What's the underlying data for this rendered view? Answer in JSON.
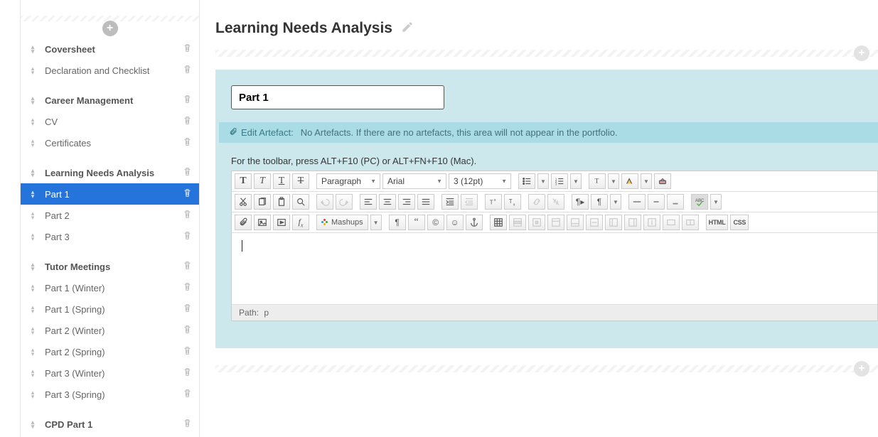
{
  "page": {
    "title": "Learning Needs Analysis"
  },
  "sidebar": {
    "groups": [
      {
        "header": "Coversheet",
        "items": [
          {
            "label": "Declaration and Checklist",
            "active": false
          }
        ]
      },
      {
        "header": "Career Management",
        "items": [
          {
            "label": "CV",
            "active": false
          },
          {
            "label": "Certificates",
            "active": false
          }
        ]
      },
      {
        "header": "Learning Needs Analysis",
        "items": [
          {
            "label": "Part 1",
            "active": true
          },
          {
            "label": "Part 2",
            "active": false
          },
          {
            "label": "Part 3",
            "active": false
          }
        ]
      },
      {
        "header": "Tutor Meetings",
        "items": [
          {
            "label": "Part 1 (Winter)",
            "active": false
          },
          {
            "label": "Part 1 (Spring)",
            "active": false
          },
          {
            "label": "Part 2 (Winter)",
            "active": false
          },
          {
            "label": "Part 2 (Spring)",
            "active": false
          },
          {
            "label": "Part 3 (Winter)",
            "active": false
          },
          {
            "label": "Part 3 (Spring)",
            "active": false
          }
        ]
      },
      {
        "header": "CPD Part 1",
        "items": []
      }
    ]
  },
  "editor": {
    "title_value": "Part 1",
    "artefact": {
      "link_label": "Edit Artefact:",
      "message": "No Artefacts. If there are no artefacts, this area will not appear in the portfolio."
    },
    "toolbar_hint": "For the toolbar, press ALT+F10 (PC) or ALT+FN+F10 (Mac).",
    "format_select": "Paragraph",
    "font_select": "Arial",
    "size_select": "3 (12pt)",
    "mashups_label": "Mashups",
    "html_label": "HTML",
    "css_label": "CSS",
    "path_label": "Path:",
    "path_value": "p"
  }
}
